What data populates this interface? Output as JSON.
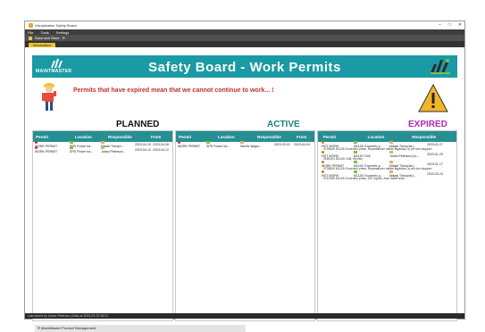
{
  "window": {
    "title": "Visualization Safety Board",
    "min": "–",
    "max": "□",
    "close": "✕"
  },
  "menu": [
    "File",
    "Tools",
    "Settings"
  ],
  "toolbar": {
    "save_label": "Save and Store",
    "refresh_label": "⟳"
  },
  "tabs": [
    {
      "label": "Information"
    }
  ],
  "brand": {
    "wordmark": "MAINTMASTER",
    "accent": "#1a9aa4"
  },
  "header": {
    "title": "Safety Board - Work Permits"
  },
  "warning": {
    "message": "Permits that have expired mean that we cannot continue to work... !"
  },
  "columns": {
    "planned": {
      "title": "PLANNED",
      "headers": [
        "Permit",
        "Location",
        "Responsible",
        "From"
      ],
      "rows": [
        {
          "permit": "WORK PERMIT",
          "location": "SPD Power Ira...",
          "responsible": "Mikael Törnqvi...",
          "from": "2023-04-10",
          "to": "2023-04-06",
          "status": "#d03030"
        },
        {
          "permit": "WORK PERMIT",
          "location": "SPD Power Ira...",
          "responsible": "Johan Peterson...",
          "from": "2023-04-10",
          "to": "2023-04-12",
          "status": "#d03030"
        }
      ]
    },
    "active": {
      "title": "ACTIVE",
      "headers": [
        "Permit",
        "Location",
        "Responsible",
        "From"
      ],
      "rows": [
        {
          "permit": "WORK PERMIT",
          "location": "SPD Power Ira...",
          "responsible": "Henrik Wagst...",
          "from": "2023-03-31",
          "to": "2023-04-04",
          "status": "#d03030"
        }
      ]
    },
    "expired": {
      "title": "EXPIRED",
      "headers": [
        "Permit",
        "Location",
        "Responsible"
      ],
      "rows": [
        {
          "permit": "HOT WORK",
          "location": "M1128: Eccentric p...",
          "responsible": "Mikael Törnqvist (...",
          "from": "2023-01-27",
          "sub": "3729649 M1128: Eccentric press, Reparationer måste åtgärdas, ej om stor stoppen",
          "status": "#d07a20"
        },
        {
          "permit": "HOT WORK",
          "location": "M1140: Drill",
          "responsible": "Johan Peterson (Jo...",
          "from": "2023-01-25",
          "sub": "3185104 M1140: Drill, Service",
          "status": "#d07a20"
        },
        {
          "permit": "WORK PERMIT",
          "location": "M1128: Eccentric p...",
          "responsible": "Mikael Törnqvist (...",
          "from": "2023-01-17",
          "sub": "3735849 M1128: Eccentric press, Reparationer måste åtgärdas, ej om stor stoppen",
          "status": "#d07a20"
        },
        {
          "permit": "HOT WORK",
          "location": "M1128: Eccentric p...",
          "responsible": "Mikael Törnqvist (...",
          "from": "2023-03-24",
          "sub": "3757455 M1128: Eccentric press, ICE ing läs. Arse fästeFaven",
          "status": "#d07a20"
        }
      ]
    }
  },
  "footer": {
    "text": "® MaintMaster Product Management"
  },
  "statusbar": {
    "text": "Last saved by Johan Peterson (Jolle) at 2023-03-13 08:21"
  },
  "colors": {
    "planned": "#111111",
    "active": "#1a7f86",
    "expired": "#b02ab8",
    "table_header": "#268f94"
  }
}
